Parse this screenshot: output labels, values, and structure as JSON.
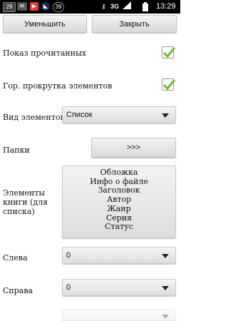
{
  "statusbar": {
    "notif_badge": "29",
    "notif_count": "39",
    "network": "3G",
    "time": "13:29"
  },
  "toolbar": {
    "decrease_label": "Уменьшить",
    "close_label": "Закрыть"
  },
  "settings": {
    "show_read_label": "Показ прочитанных",
    "show_read_checked": true,
    "hscroll_label": "Гор. прокрутка элементов",
    "hscroll_checked": true,
    "view_label": "Вид элементов",
    "view_value": "Список",
    "folders_label": "Папки",
    "folders_button": ">>>",
    "book_elements_label": "Элементы книги (для списка)",
    "book_elements": [
      "Обложка",
      "Инфо о файле",
      "Заголовок",
      "Автор",
      "Жанр",
      "Серия",
      "Статус"
    ],
    "left_label": "Слева",
    "left_value": "0",
    "right_label": "Справа",
    "right_value": "0"
  },
  "colors": {
    "check_green": "#6fba2c",
    "statusbar_bg": "#000000"
  }
}
